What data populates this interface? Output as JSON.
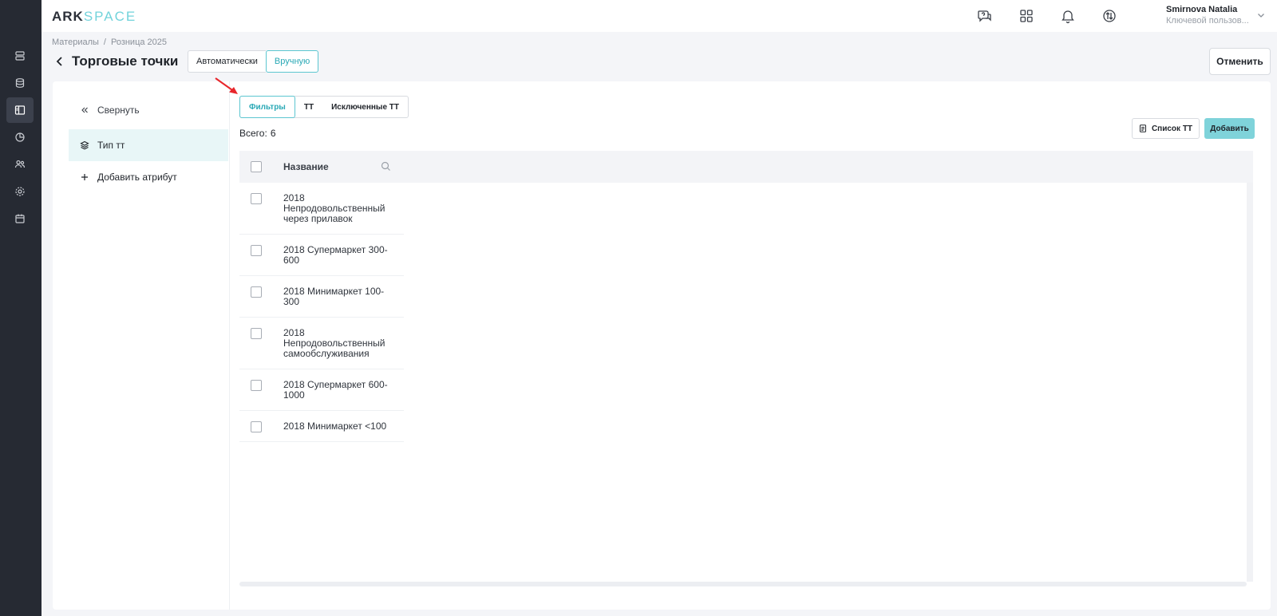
{
  "app": {
    "logo_part1": "ARK",
    "logo_part2": "SPACE"
  },
  "user": {
    "name": "Smirnova Natalia",
    "role": "Ключевой пользов..."
  },
  "breadcrumb": {
    "items": [
      "Материалы",
      "Розница 2025"
    ],
    "separator": "/"
  },
  "page": {
    "title": "Торговые точки",
    "mode_auto": "Автоматически",
    "mode_manual": "Вручную",
    "cancel_label": "Отменить"
  },
  "left_panel": {
    "collapse_label": "Свернуть",
    "attribute_label": "Тип тт",
    "add_attribute_label": "Добавить атрибут"
  },
  "tabs": {
    "filters": "Фильтры",
    "tt": "ТТ",
    "excluded": "Исключенные ТТ"
  },
  "summary": {
    "total_label": "Всего:",
    "total_value": "6"
  },
  "actions": {
    "list_label": "Список ТТ",
    "add_label": "Добавить"
  },
  "table": {
    "column_name": "Название",
    "rows": [
      "2018 Непродовольственный через прилавок",
      "2018 Супермаркет 300-600",
      "2018 Минимаркет 100-300",
      "2018 Непродовольственный самообслуживания",
      "2018 Супермаркет 600-1000",
      "2018 Минимаркет <100"
    ]
  },
  "colors": {
    "accent": "#5cc6d0",
    "primary_button": "#7fd3da",
    "rail": "#262a33",
    "annotation_arrow": "#e8262b"
  }
}
